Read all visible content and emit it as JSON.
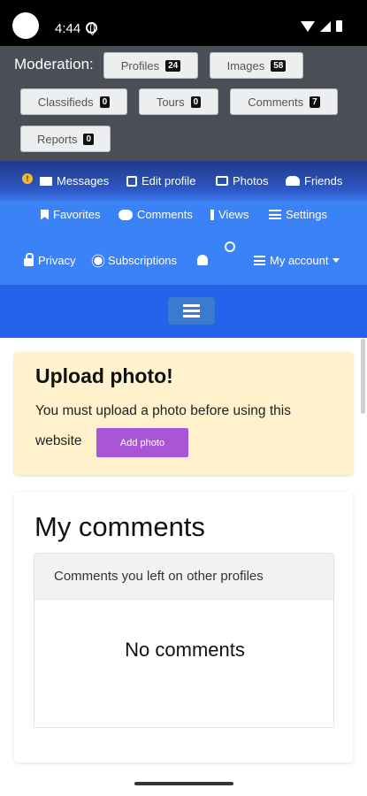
{
  "status": {
    "time": "4:44"
  },
  "moderation": {
    "label": "Moderation:",
    "buttons": [
      {
        "label": "Profiles",
        "count": "24"
      },
      {
        "label": "Images",
        "count": "58"
      },
      {
        "label": "Classifieds",
        "count": "0"
      },
      {
        "label": "Tours",
        "count": "0"
      },
      {
        "label": "Comments",
        "count": "7"
      },
      {
        "label": "Reports",
        "count": "0"
      }
    ]
  },
  "nav": {
    "warning_badge": "!",
    "row1": [
      "Messages",
      "Edit profile",
      "Photos",
      "Friends"
    ],
    "row2": [
      "Favorites",
      "Comments",
      "Views",
      "Settings"
    ],
    "row3": [
      "Privacy",
      "Subscriptions",
      "My account"
    ]
  },
  "alert": {
    "title": "Upload photo!",
    "line1": "You must upload a photo before using this",
    "line2": "website",
    "button": "Add photo"
  },
  "comments": {
    "title": "My comments",
    "subtitle": "Comments you left on other profiles",
    "empty": "No comments"
  }
}
